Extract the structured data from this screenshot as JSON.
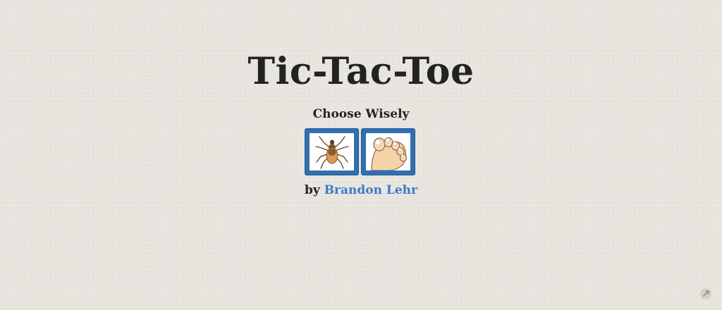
{
  "title": "Tic-Tac-Toe",
  "subtitle": "Choose Wisely",
  "choices": [
    {
      "name": "tick",
      "icon": "tick-icon"
    },
    {
      "name": "toe",
      "icon": "toe-icon"
    }
  ],
  "byline": {
    "prefix": "by",
    "author": "Brandon Lehr"
  },
  "colors": {
    "background": "#e7e4de",
    "button": "#2f6fb2",
    "link": "#3a7bc8",
    "text": "#222222"
  }
}
